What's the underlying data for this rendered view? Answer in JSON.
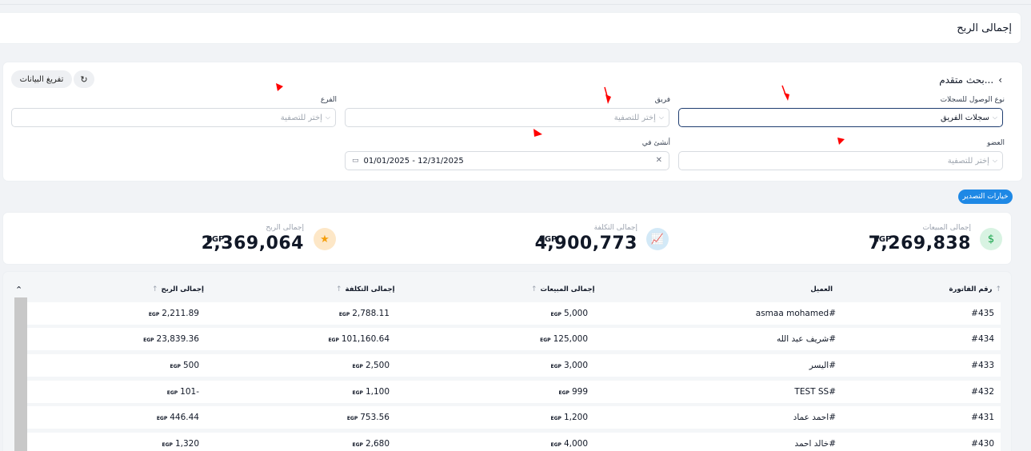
{
  "page": {
    "title": "إجمالى الربح"
  },
  "filters": {
    "advanced_search": "بحث متقدم...",
    "clear_button": "تفريغ البيانات",
    "refresh_icon": "refresh-icon",
    "access_type_label": "نوع الوصول للسجلات",
    "access_type_value": "سجلات الفريق",
    "team_label": "فريق",
    "team_placeholder": "إختر للتصفية",
    "branch_label": "الفرع",
    "branch_placeholder": "إختر للتصفية",
    "member_label": "العضو",
    "member_placeholder": "إختر للتصفية",
    "created_label": "أنشئ في",
    "created_value": "01/01/2025 - 12/31/2025"
  },
  "export_button": "خيارات التصدير",
  "stats": {
    "sales_label": "إجمالى المبيعات",
    "sales_value": "7,269,838",
    "cost_label": "إجمالى التكلفة",
    "cost_value": "4,900,773",
    "profit_label": "إجمالى الربح",
    "profit_value": "2,369,064",
    "currency": "EGP"
  },
  "table": {
    "headers": {
      "invoice": "رقم الفاتورة",
      "customer": "العميل",
      "sales": "إجمالى المبيعات",
      "cost": "إجمالى التكلفة",
      "profit": "إجمالى الربح"
    },
    "currency": "EGP",
    "rows": [
      {
        "invoice": "#435",
        "customer": "asmaa mohamed#",
        "sales": "5,000",
        "cost": "2,788.11",
        "profit": "2,211.89"
      },
      {
        "invoice": "#434",
        "customer": "شريف عبد الله#",
        "sales": "125,000",
        "cost": "101,160.64",
        "profit": "23,839.36"
      },
      {
        "invoice": "#433",
        "customer": "اليسر#",
        "sales": "3,000",
        "cost": "2,500",
        "profit": "500"
      },
      {
        "invoice": "#432",
        "customer": "TEST SS#",
        "sales": "999",
        "cost": "1,100",
        "profit": "101-"
      },
      {
        "invoice": "#431",
        "customer": "احمد عماد#",
        "sales": "1,200",
        "cost": "753.56",
        "profit": "446.44"
      },
      {
        "invoice": "#430",
        "customer": "خالد احمد#",
        "sales": "4,000",
        "cost": "2,680",
        "profit": "1,320"
      }
    ]
  },
  "colors": {
    "accent": "#1e88e5",
    "annotation_arrow": "#ff0000",
    "active_border": "#1f3d70"
  }
}
